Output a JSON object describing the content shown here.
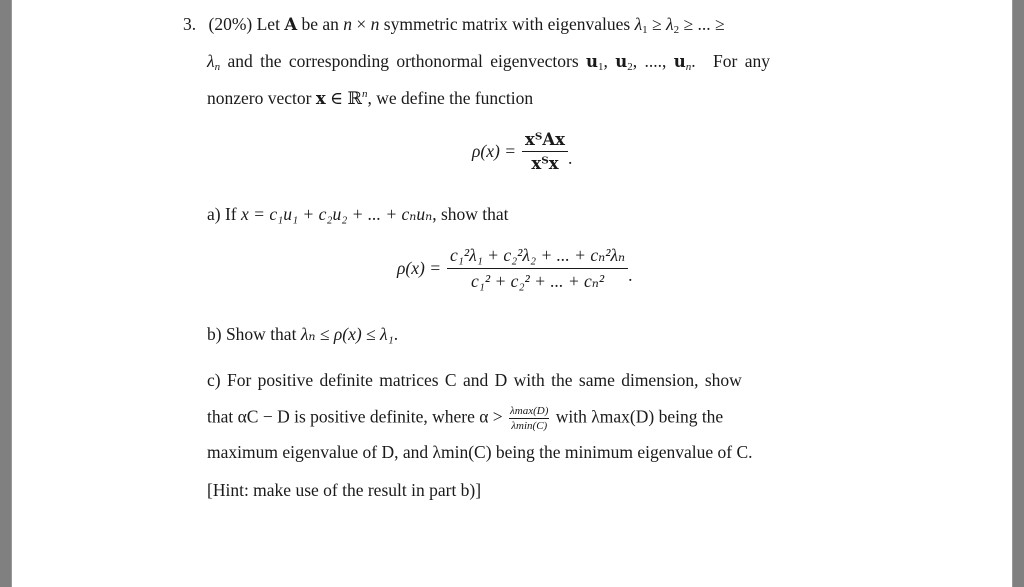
{
  "problem": {
    "number": "3.",
    "weight": "(20%)",
    "intro_line1": {
      "t1": "Let",
      "A": "A",
      "t2": "be an",
      "n": "n",
      "times": "×",
      "t3": "symmetric matrix with eigenvalues",
      "lam": "λ",
      "s1": "1",
      "geq": "≥",
      "s2": "2",
      "dots": "...",
      "geq2": "≥"
    },
    "intro_line2": {
      "lam": "λ",
      "sn": "n",
      "t1": "and the corresponding orthonormal eigenvectors",
      "u": "u",
      "s1": "1",
      "s2": "2",
      "sep": ", ....,",
      "sn2": "n",
      "t2": ".",
      "t3": "For any"
    },
    "intro_line3": {
      "t1": "nonzero vector",
      "x": "x",
      "in": "∈",
      "R": "ℝ",
      "sup": "n",
      "t2": ", we define the function"
    },
    "rayleigh": {
      "lhs": "ρ(x) =",
      "num": "xᵀAx",
      "den": "xᵀx",
      "end": "."
    },
    "part_a": {
      "label": "a)",
      "text_before": "If",
      "expr": "x = c₁u₁ + c₂u₂ + ... + cₙuₙ",
      "text_after": ", show that",
      "formula": {
        "lhs": "ρ(x) =",
        "num": "c₁²λ₁ + c₂²λ₂ + ... + cₙ²λₙ",
        "den": "c₁² + c₂² + ... + cₙ²",
        "end": "."
      }
    },
    "part_b": {
      "label": "b)",
      "text": "Show that",
      "expr": "λₙ ≤ ρ(x) ≤ λ₁",
      "end": "."
    },
    "part_c": {
      "label": "c)",
      "line1": "For positive definite matrices C and D with the same dimension, show",
      "line2_a": "that αC − D is positive definite, where α >",
      "frac_num": "λmax(D)",
      "frac_den": "λmin(C)",
      "line2_b": "with λmax(D) being the",
      "line3": "maximum eigenvalue of D, and λmin(C) being the minimum eigenvalue of C.",
      "hint": "[Hint: make use of the result in part b)]"
    }
  }
}
